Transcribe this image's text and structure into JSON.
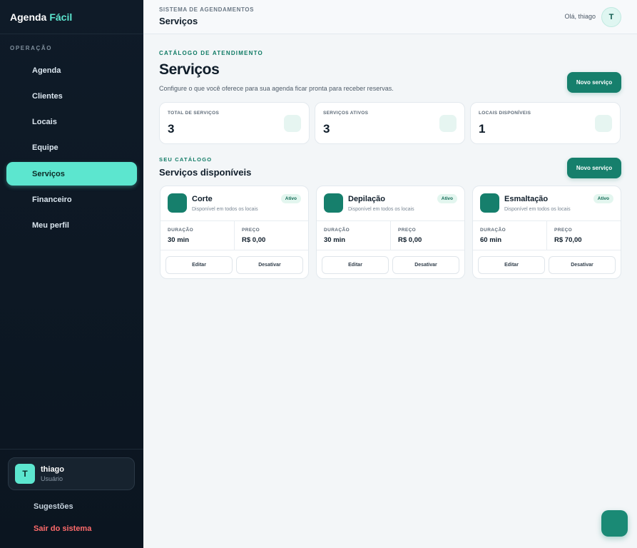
{
  "brand": {
    "part1": "Agenda",
    "part2": "Fácil"
  },
  "sidebar": {
    "section_label": "OPERAÇÃO",
    "items": [
      {
        "label": "Agenda",
        "active": false
      },
      {
        "label": "Clientes",
        "active": false
      },
      {
        "label": "Locais",
        "active": false
      },
      {
        "label": "Equipe",
        "active": false
      },
      {
        "label": "Serviços",
        "active": true
      },
      {
        "label": "Financeiro",
        "active": false
      },
      {
        "label": "Meu perfil",
        "active": false
      }
    ],
    "user": {
      "initial": "T",
      "name": "thiago",
      "role": "Usuário"
    },
    "suggestions_label": "Sugestões",
    "logout_label": "Sair do sistema"
  },
  "header": {
    "subtitle": "SISTEMA DE AGENDAMENTOS",
    "title": "Serviços",
    "greeting": "Olá, thiago",
    "avatar_initial": "T"
  },
  "main": {
    "kicker": "CATÁLOGO DE ATENDIMENTO",
    "title": "Serviços",
    "description": "Configure o que você oferece para sua agenda ficar pronta para receber reservas.",
    "new_service_label": "Novo serviço",
    "stats": [
      {
        "label": "TOTAL DE SERVIÇOS",
        "value": "3"
      },
      {
        "label": "SERVIÇOS ATIVOS",
        "value": "3"
      },
      {
        "label": "LOCAIS DISPONÍVEIS",
        "value": "1"
      }
    ],
    "catalog": {
      "kicker": "SEU CATÁLOGO",
      "title": "Serviços disponíveis",
      "new_service_label": "Novo serviço",
      "duration_label": "DURAÇÃO",
      "price_label": "PREÇO",
      "edit_label": "Editar",
      "deactivate_label": "Desativar",
      "services": [
        {
          "name": "Corte",
          "availability": "Disponível em todos os locais",
          "status": "Ativo",
          "duration": "30 min",
          "price": "R$ 0,00"
        },
        {
          "name": "Depilação",
          "availability": "Disponível em todos os locais",
          "status": "Ativo",
          "duration": "30 min",
          "price": "R$ 0,00"
        },
        {
          "name": "Esmaltação",
          "availability": "Disponível em todos os locais",
          "status": "Ativo",
          "duration": "60 min",
          "price": "R$ 70,00"
        }
      ]
    }
  },
  "colors": {
    "accent": "#5ce6cf",
    "primary": "#167f6c",
    "sidebar_bg": "#0f1b28",
    "danger": "#ff6b6b"
  }
}
